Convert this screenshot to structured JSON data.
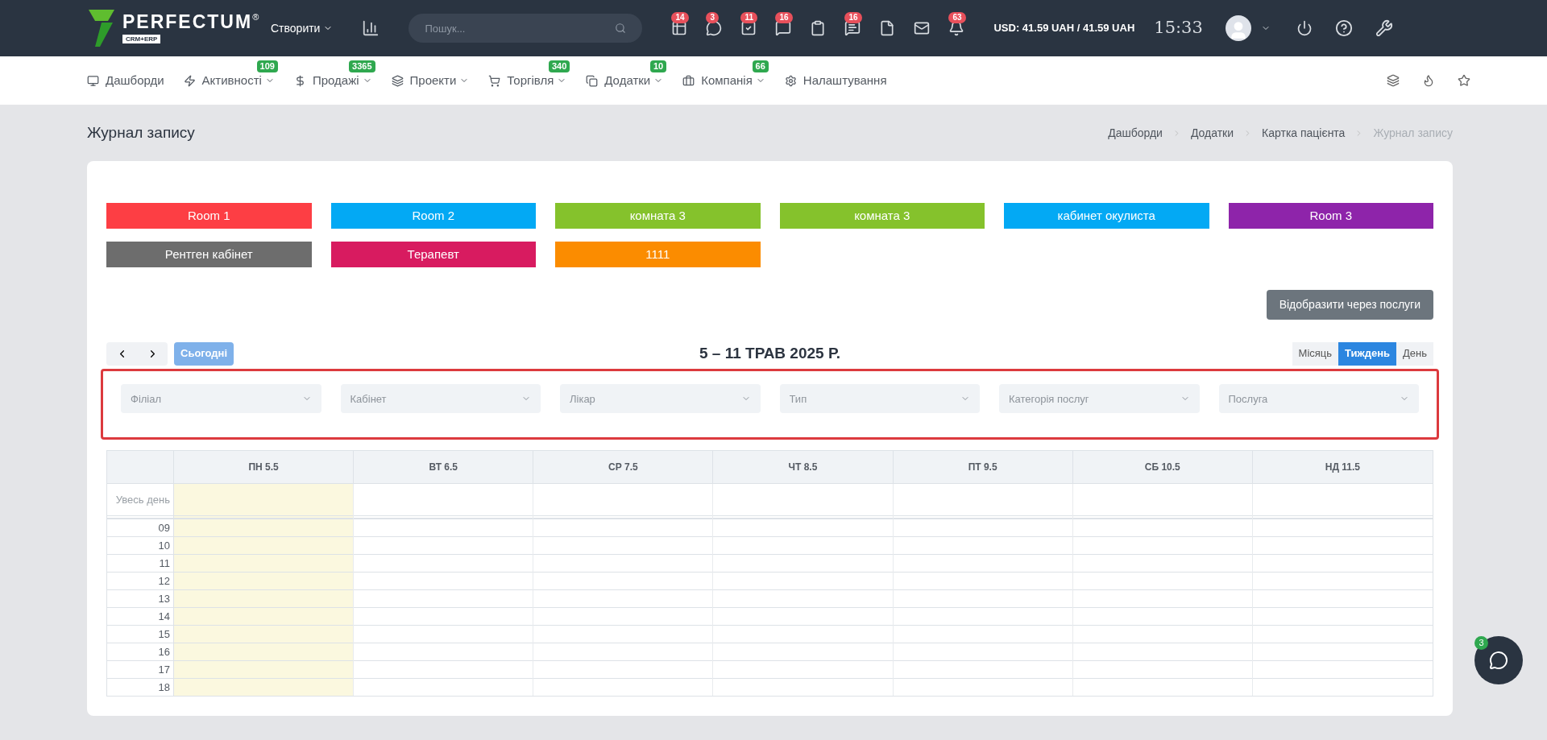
{
  "topbar": {
    "logo": "PERFECTUM",
    "logo_mark": "®",
    "logo_sub": "CRM+ERP",
    "create": "Створити",
    "search": {
      "placeholder": "Пошук..."
    },
    "notifications": [
      {
        "kind": "counted",
        "count": "14"
      },
      {
        "kind": "counted",
        "count": "3"
      },
      {
        "kind": "counted",
        "count": "11"
      },
      {
        "kind": "counted",
        "count": "16"
      },
      {
        "kind": "plain"
      },
      {
        "kind": "counted",
        "count": "16"
      },
      {
        "kind": "plain"
      },
      {
        "kind": "plain"
      },
      {
        "kind": "counted",
        "count": "63"
      }
    ],
    "currency": "USD: 41.59 UAH / 41.59 UAH",
    "time": "15:33"
  },
  "nav": [
    {
      "label": "Дашборди",
      "has_menu": false
    },
    {
      "label": "Активності",
      "badge": "109",
      "has_menu": true
    },
    {
      "label": "Продажі",
      "badge": "3365",
      "has_menu": true
    },
    {
      "label": "Проекти",
      "has_menu": true
    },
    {
      "label": "Торгівля",
      "badge": "340",
      "has_menu": true
    },
    {
      "label": "Додатки",
      "badge": "10",
      "has_menu": true
    },
    {
      "label": "Компанія",
      "badge": "66",
      "has_menu": true
    },
    {
      "label": "Налаштування",
      "has_menu": false
    }
  ],
  "page_title": "Журнал запису",
  "breadcrumbs": [
    {
      "label": "Дашборди",
      "current": false
    },
    {
      "label": "Додатки",
      "current": false
    },
    {
      "label": "Картка пацієнта",
      "current": false
    },
    {
      "label": "Журнал запису",
      "current": true
    }
  ],
  "rooms": [
    {
      "label": "Room 1",
      "color": "#fd3e44"
    },
    {
      "label": "Room 2",
      "color": "#03a9f4"
    },
    {
      "label": "комната 3",
      "color": "#85c22c"
    },
    {
      "label": "комната 3",
      "color": "#85c22c"
    },
    {
      "label": "кабинет окулиста",
      "color": "#03a9f4"
    },
    {
      "label": "Room 3",
      "color": "#8e24aa"
    },
    {
      "label": "Рентген кабінет",
      "color": "#6d6d6d"
    },
    {
      "label": "Терапевт",
      "color": "#d81b60"
    },
    {
      "label": "1111",
      "color": "#fb8c00"
    }
  ],
  "services_button": "Відобразити через послуги",
  "calendar": {
    "today_button": "Сьогодні",
    "range": "5 – 11 ТРАВ 2025 Р.",
    "views": [
      {
        "label": "Місяць",
        "selected": false
      },
      {
        "label": "Тиждень",
        "selected": true
      },
      {
        "label": "День",
        "selected": false
      }
    ],
    "filters": [
      {
        "placeholder": "Філіал"
      },
      {
        "placeholder": "Кабінет"
      },
      {
        "placeholder": "Лікар"
      },
      {
        "placeholder": "Тип"
      },
      {
        "placeholder": "Категорія послуг"
      },
      {
        "placeholder": "Послуга"
      }
    ],
    "days": [
      {
        "label": "ПН 5.5",
        "today": true
      },
      {
        "label": "ВТ 6.5",
        "today": false
      },
      {
        "label": "СР 7.5",
        "today": false
      },
      {
        "label": "ЧТ 8.5",
        "today": false
      },
      {
        "label": "ПТ 9.5",
        "today": false
      },
      {
        "label": "СБ 10.5",
        "today": false
      },
      {
        "label": "НД 11.5",
        "today": false
      }
    ],
    "all_day": "Увесь день",
    "hours": [
      "09",
      "10",
      "11",
      "12",
      "13",
      "14",
      "15",
      "16",
      "17",
      "18"
    ]
  },
  "chat": {
    "badge": "3"
  }
}
